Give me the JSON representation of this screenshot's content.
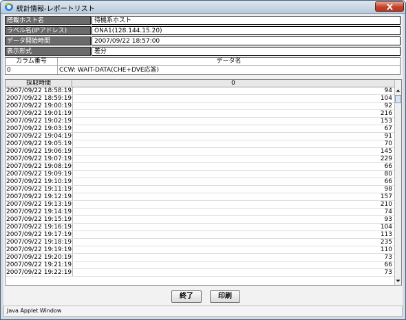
{
  "window": {
    "title": "統計情報-レポートリスト",
    "close_label": "×"
  },
  "info": [
    {
      "label": "搭載ホスト名",
      "value": "待機系ホスト"
    },
    {
      "label": "ラベル名(IPアドレス)",
      "value": "ONA1(128.144.15.20)"
    },
    {
      "label": "データ開始時間",
      "value": "2007/09/22 18:57:00"
    },
    {
      "label": "表示形式",
      "value": "差分"
    }
  ],
  "columns": {
    "header_no": "カラム番号",
    "header_name": "データ名",
    "no": "0",
    "name": "CCW: WAIT-DATA(CHE+DVE応答)"
  },
  "grid": {
    "header_time": "採取時間",
    "header_value": "0",
    "rows": [
      {
        "time": "2007/09/22 18:58:19",
        "value": "94"
      },
      {
        "time": "2007/09/22 18:59:19",
        "value": "104"
      },
      {
        "time": "2007/09/22 19:00:19",
        "value": "92"
      },
      {
        "time": "2007/09/22 19:01:19",
        "value": "216"
      },
      {
        "time": "2007/09/22 19:02:19",
        "value": "153"
      },
      {
        "time": "2007/09/22 19:03:19",
        "value": "67"
      },
      {
        "time": "2007/09/22 19:04:19",
        "value": "91"
      },
      {
        "time": "2007/09/22 19:05:19",
        "value": "70"
      },
      {
        "time": "2007/09/22 19:06:19",
        "value": "145"
      },
      {
        "time": "2007/09/22 19:07:19",
        "value": "229"
      },
      {
        "time": "2007/09/22 19:08:19",
        "value": "66"
      },
      {
        "time": "2007/09/22 19:09:19",
        "value": "80"
      },
      {
        "time": "2007/09/22 19:10:19",
        "value": "66"
      },
      {
        "time": "2007/09/22 19:11:19",
        "value": "98"
      },
      {
        "time": "2007/09/22 19:12:19",
        "value": "157"
      },
      {
        "time": "2007/09/22 19:13:19",
        "value": "210"
      },
      {
        "time": "2007/09/22 19:14:19",
        "value": "74"
      },
      {
        "time": "2007/09/22 19:15:19",
        "value": "93"
      },
      {
        "time": "2007/09/22 19:16:19",
        "value": "104"
      },
      {
        "time": "2007/09/22 19:17:19",
        "value": "113"
      },
      {
        "time": "2007/09/22 19:18:19",
        "value": "235"
      },
      {
        "time": "2007/09/22 19:19:19",
        "value": "110"
      },
      {
        "time": "2007/09/22 19:20:19",
        "value": "73"
      },
      {
        "time": "2007/09/22 19:21:19",
        "value": "66"
      },
      {
        "time": "2007/09/22 19:22:19",
        "value": "73"
      }
    ]
  },
  "buttons": {
    "end": "終了",
    "print": "印刷"
  },
  "status": "Java Applet Window"
}
